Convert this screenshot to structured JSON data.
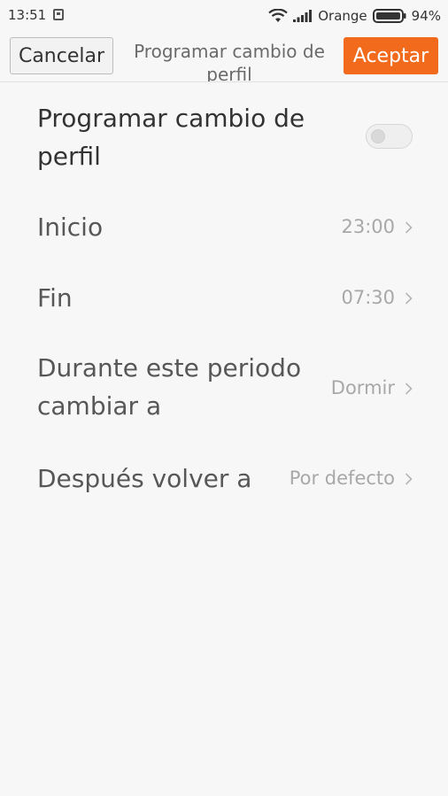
{
  "status_bar": {
    "time": "13:51",
    "carrier": "Orange",
    "battery": "94%"
  },
  "header": {
    "cancel_label": "Cancelar",
    "title": "Programar cambio de perfil",
    "accept_label": "Aceptar",
    "accent_color": "#f26b1d"
  },
  "settings": {
    "schedule": {
      "label": "Programar cambio de perfil",
      "enabled": false
    },
    "start": {
      "label": "Inicio",
      "value": "23:00"
    },
    "end": {
      "label": "Fin",
      "value": "07:30"
    },
    "during": {
      "label": "Durante este periodo cambiar a",
      "value": "Dormir"
    },
    "after": {
      "label": "Después volver a",
      "value": "Por defecto"
    }
  }
}
